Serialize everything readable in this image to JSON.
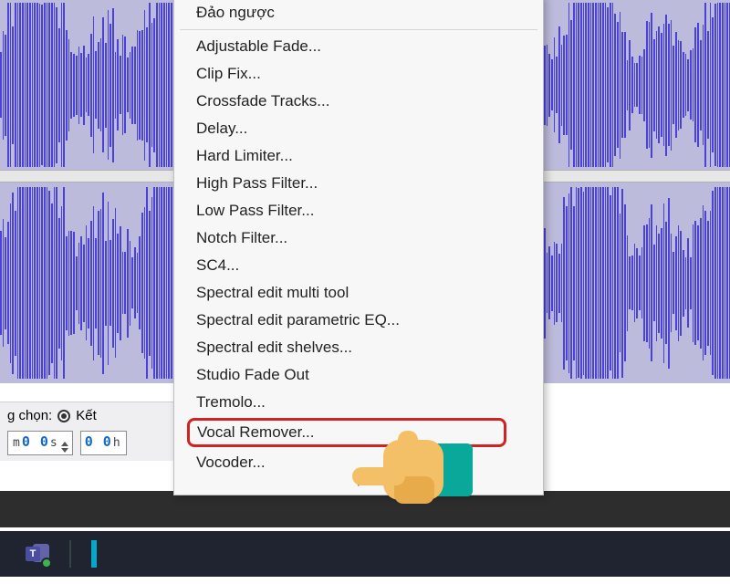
{
  "menu": {
    "top_item": "Đảo ngược",
    "items": [
      "Adjustable Fade...",
      "Clip Fix...",
      "Crossfade Tracks...",
      "Delay...",
      "Hard Limiter...",
      "High Pass Filter...",
      "Low Pass Filter...",
      "Notch Filter...",
      "SC4...",
      "Spectral edit multi tool",
      "Spectral edit parametric EQ...",
      "Spectral edit shelves...",
      "Studio Fade Out",
      "Tremolo...",
      "Vocal Remover...",
      "Vocoder..."
    ],
    "highlight_index": 14
  },
  "controls": {
    "selection_label_suffix": "g chọn:",
    "radio_label": "Kết",
    "time1": {
      "prefix": "m",
      "d1": "0 0",
      "unit1": "s",
      "tail": "▾"
    },
    "time2": {
      "d1": "0 0",
      "unit1": "h"
    }
  },
  "taskbar": {
    "teams_letter": "T"
  },
  "colors": {
    "highlight_border": "#d22323",
    "hand_skin": "#f4c067",
    "hand_cuff": "#0aa79b",
    "waveform": "#4a42d6"
  }
}
